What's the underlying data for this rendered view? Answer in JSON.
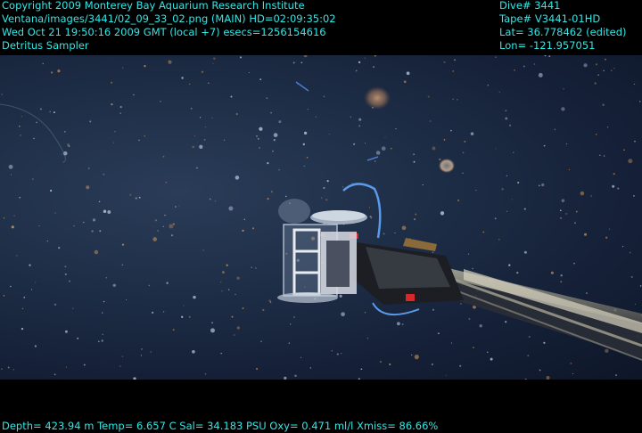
{
  "header": {
    "left_lines": [
      "Copyright 2009 Monterey Bay Aquarium Research Institute",
      "Ventana/images/3441/02_09_33_02.png (MAIN)  HD=02:09:35:02",
      "Wed Oct 21 19:50:16 2009 GMT (local +7)  esecs=1256154616",
      "Detritus Sampler"
    ],
    "right_lines": [
      "Dive# 3441",
      "Tape# V3441-01HD",
      "Lat= 36.778462 (edited)",
      "Lon= -121.957051"
    ]
  },
  "footer": {
    "telemetry": "Depth= 423.94 m  Temp= 6.657 C  Sal= 34.183 PSU  Oxy= 0.471 ml/l  Xmiss= 86.66%"
  },
  "colors": {
    "overlay_text": "#33e6e6",
    "background": "#000000",
    "water_light": "#2a3c58",
    "water_dark": "#0e1628"
  },
  "scene": {
    "subjects": [
      "detritus-sampler",
      "rov-arm",
      "marine-snow",
      "jellyfish"
    ]
  }
}
